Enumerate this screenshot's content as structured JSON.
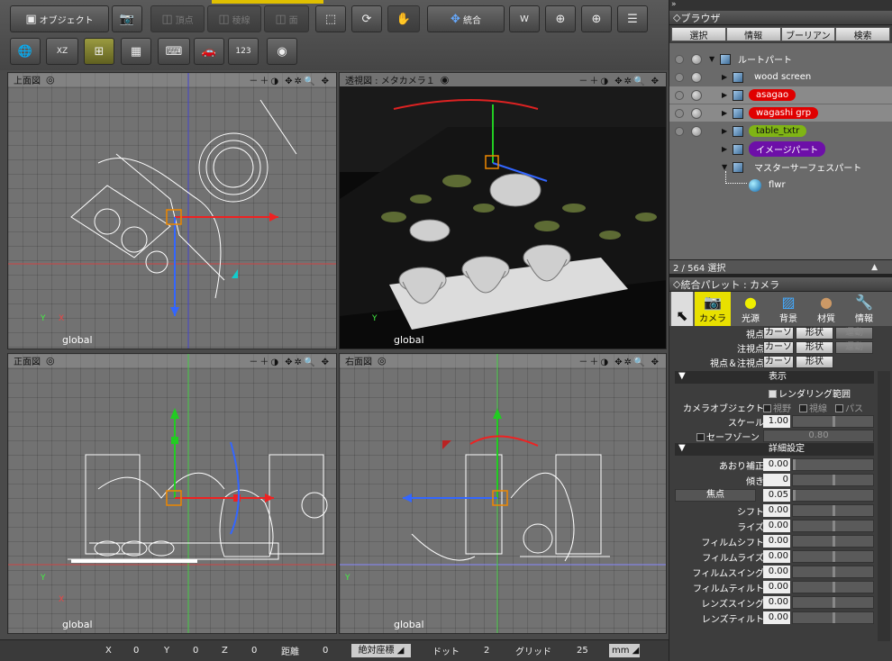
{
  "toolbar": {
    "object_label": "オブジェクト",
    "vertex_label": "頂点",
    "edge_label": "稜線",
    "face_label": "面",
    "integrated_label": "統合",
    "wxyz_label": "W",
    "row2_btn_123": "123"
  },
  "viewports": {
    "top": {
      "title": "上面図",
      "coord": "global"
    },
    "perspective": {
      "title": "透視図 : メタカメラ１",
      "coord": "global"
    },
    "front": {
      "title": "正面図",
      "coord": "global"
    },
    "right": {
      "title": "右面図",
      "coord": "global"
    },
    "header_controls": "－＋◑ ✥✲🔍 ✥"
  },
  "statusbar": {
    "x_label": "X",
    "x_value": "0",
    "y_label": "Y",
    "y_value": "0",
    "z_label": "Z",
    "z_value": "0",
    "distance_label": "距離",
    "distance_value": "0",
    "coord_mode": "絶対座標",
    "dot_label": "ドット",
    "dot_value": "2",
    "grid_label": "グリッド",
    "grid_value": "25",
    "unit": "mm"
  },
  "browser": {
    "panel_title": "ブラウザ",
    "tabs": [
      "選択",
      "情報",
      "ブーリアン",
      "検索"
    ],
    "items": [
      {
        "label": "ルートパート"
      },
      {
        "label": "wood screen"
      },
      {
        "label": "asagao"
      },
      {
        "label": "wagashi grp"
      },
      {
        "label": "table_txtr"
      },
      {
        "label": "イメージパート"
      },
      {
        "label": "マスターサーフェスパート"
      },
      {
        "label": "flwr"
      }
    ],
    "selection_count": "2 / 564 選択"
  },
  "palette": {
    "title": "統合パレット : カメラ",
    "tabs": [
      {
        "label": "カメラ",
        "icon": "camera-icon",
        "selected": true
      },
      {
        "label": "光源",
        "icon": "sun-icon"
      },
      {
        "label": "背景",
        "icon": "background-icon"
      },
      {
        "label": "材質",
        "icon": "material-sphere-icon"
      },
      {
        "label": "情報",
        "icon": "wrench-icon"
      }
    ],
    "rows": {
      "viewpoint": "視点",
      "target": "注視点",
      "viewpoint_target": "視点＆注視点",
      "cursor": "カーソ",
      "shape": "形状",
      "move": "運動",
      "display_section": "表示",
      "render_range": "レンダリング範囲",
      "camera_object": "カメラオブジェクト",
      "view_field": "視野",
      "view_line": "視線",
      "path": "パス",
      "scale_label": "スケール",
      "scale_value": "1.00",
      "safezone_label": "セーフゾーン",
      "safezone_value": "0.80",
      "detail_section": "詳細設定",
      "tilt_label": "あおり補正",
      "tilt_value": "0.00",
      "lean_label": "傾き",
      "lean_value": "0",
      "focus_label": "焦点",
      "focus_value": "0.05",
      "shift_label": "シフト",
      "shift_value": "0.00",
      "rise_label": "ライズ",
      "rise_value": "0.00",
      "fshift_label": "フィルムシフト",
      "fshift_value": "0.00",
      "frise_label": "フィルムライズ",
      "frise_value": "0.00",
      "fswing_label": "フィルムスイング",
      "fswing_value": "0.00",
      "ftilt_label": "フィルムティルト",
      "ftilt_value": "0.00",
      "lswing_label": "レンズスイング",
      "lswing_value": "0.00",
      "ltilt_label": "レンズティルト",
      "ltilt_value": "0.00"
    }
  }
}
